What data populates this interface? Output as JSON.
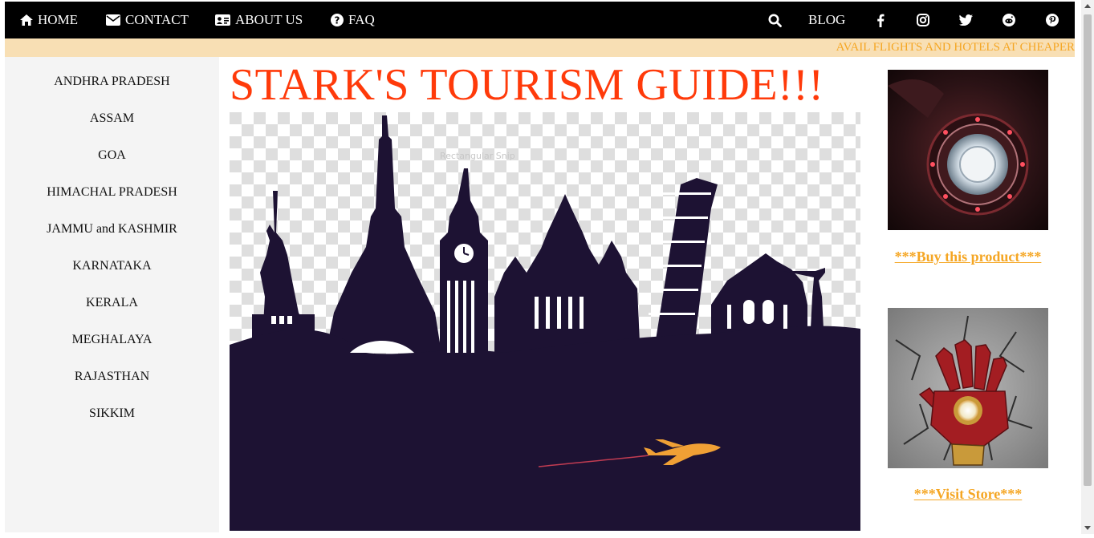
{
  "nav": {
    "home": "HOME",
    "contact": "CONTACT",
    "about": "ABOUT US",
    "faq": "FAQ",
    "blog": "BLOG",
    "icons": [
      "search-icon",
      "facebook-icon",
      "instagram-icon",
      "twitter-icon",
      "reddit-icon",
      "pinterest-icon"
    ]
  },
  "marquee": "AVAIL FLIGHTS AND HOTELS AT CHEAPER",
  "sidebar": {
    "items": [
      "ANDHRA PRADESH",
      "ASSAM",
      "GOA",
      "HIMACHAL PRADESH",
      "JAMMU and KASHMIR",
      "KARNATAKA",
      "KERALA",
      "MEGHALAYA",
      "RAJASTHAN",
      "SIKKIM"
    ]
  },
  "main": {
    "title": "STARK'S TOURISM GUIDE!!!",
    "watermark": "Rectangular Snip"
  },
  "aside": {
    "product1_link": "***Buy this product***",
    "product2_link": "***Visit Store***"
  },
  "colors": {
    "nav_bg": "#000000",
    "title": "#ff3a0a",
    "link": "#f5a623",
    "marquee_bg": "#f8dfb4",
    "silhouette": "#1d1233"
  }
}
